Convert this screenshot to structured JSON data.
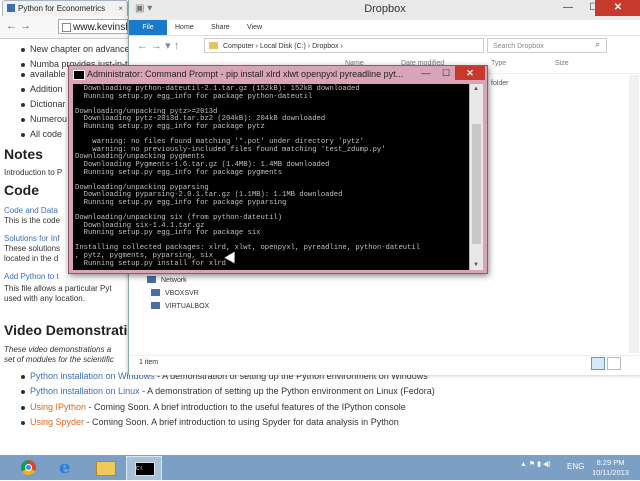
{
  "browser": {
    "tab_title": "Python for Econometrics",
    "tab_close": "×",
    "nav_glyphs": "← →",
    "url": "www.kevinsheppard.com",
    "page": {
      "bullets_top": [
        "New chapter on advanced",
        "Numba provides just-in-time",
        "available",
        "Addition",
        "Dictionar",
        "Numerou",
        "All code"
      ],
      "notes_heading": "Notes",
      "notes_text": "Introduction to P",
      "code_heading": "Code",
      "code_link": "Code and Data",
      "code_text": "This is the code",
      "solutions_link": "Solutions for Inf",
      "solutions_text1": "These solutions",
      "solutions_text2": "located in the d",
      "addpath_link": "Add Python to t",
      "addpath_text1": "This file allows a particular Pyt",
      "addpath_text2": "used with any location.",
      "video_heading": "Video Demonstration",
      "video_intro1": "These video demonstrations a",
      "video_intro2": "set of modules for the scientific",
      "videos": [
        {
          "link": "Python installation on Windows",
          "desc": " - A demonstration of setting up the Python environment on Windows",
          "style": "link"
        },
        {
          "link": "Python installation on Linux",
          "desc": " - A demonstration of setting up the Python environment on Linux (Fedora)",
          "style": "link"
        },
        {
          "link": "Using IPython",
          "desc": " - Coming Soon. A brief introduction to the useful features of the IPython console",
          "style": "orange"
        },
        {
          "link": "Using Spyder",
          "desc": " - Coming Soon. A brief introduction to using Spyder for data analysis in Python",
          "style": "orange"
        }
      ]
    }
  },
  "explorer": {
    "title": "Dropbox",
    "ribbon_tabs": [
      "File",
      "Home",
      "Share",
      "View"
    ],
    "path": "Computer  ›  Local Disk (C:)  ›  Dropbox  ›",
    "search_placeholder": "Search Dropbox",
    "columns": [
      "Name",
      "Date modified",
      "Type",
      "Size"
    ],
    "partial_type": "folder",
    "tree": [
      "Network",
      "VBOXSVR",
      "VIRTUALBOX"
    ],
    "status_items": "1 item",
    "win_min": "—",
    "win_max": "☐",
    "win_close": "✕"
  },
  "cmd": {
    "title": "Administrator: Command Prompt - pip  install xlrd xlwt openpyxl pyreadline pyt...",
    "min": "—",
    "max": "☐",
    "close": "✕",
    "lines": [
      "  Downloading python-dateutil-2.1.tar.gz (152kB): 152kB downloaded",
      "  Running setup.py egg_info for package python-dateutil",
      "",
      "Downloading/unpacking pytz>=2013d",
      "  Downloading pytz-2013d.tar.bz2 (204kB): 204kB downloaded",
      "  Running setup.py egg_info for package pytz",
      "",
      "    warning: no files found matching '*.pot' under directory 'pytz'",
      "    warning: no previously-included files found matching 'test_zdump.py'",
      "Downloading/unpacking pygments",
      "  Downloading Pygments-1.6.tar.gz (1.4MB): 1.4MB downloaded",
      "  Running setup.py egg_info for package pygments",
      "",
      "Downloading/unpacking pyparsing",
      "  Downloading pyparsing-2.0.1.tar.gz (1.1MB): 1.1MB downloaded",
      "  Running setup.py egg_info for package pyparsing",
      "",
      "Downloading/unpacking six (from python-dateutil)",
      "  Downloading six-1.4.1.tar.gz",
      "  Running setup.py egg_info for package six",
      "",
      "Installing collected packages: xlrd, xlwt, openpyxl, pyreadline, python-dateutil",
      ", pytz, pygments, pyparsing, six",
      "  Running setup.py install for xlrd"
    ]
  },
  "taskbar": {
    "cmd_glyph": "C:\\",
    "tray_glyphs": "▲ ⚑ ▮ ◀)",
    "lang": "ENG",
    "time": "8:29 PM",
    "date": "10/11/2013"
  }
}
